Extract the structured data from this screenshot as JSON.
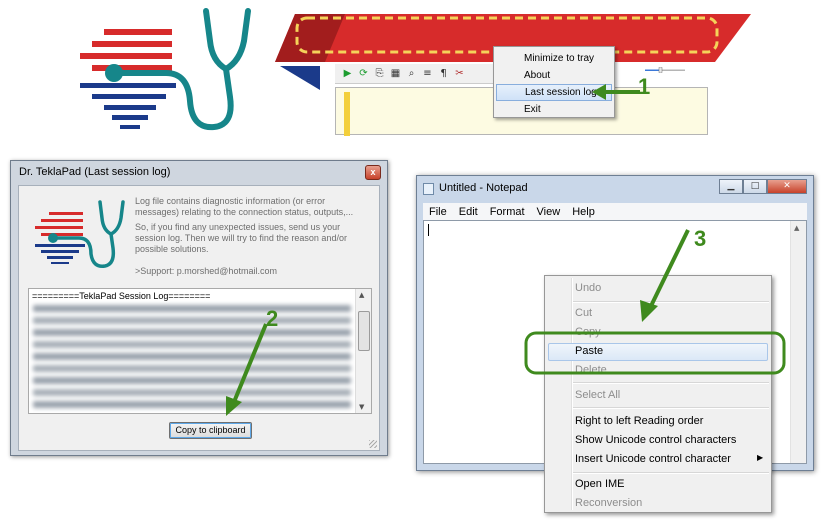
{
  "colors": {
    "brand_red": "#d72b2b",
    "brand_navy": "#1b3a8a",
    "stethoscope_teal": "#16868a",
    "annotation_green": "#3f8a1e",
    "highlight_yellow": "#f5d35a"
  },
  "top": {
    "tray_menu": {
      "items": [
        "Minimize to tray",
        "About",
        "Last session log",
        "Exit"
      ],
      "highlighted": "Last session log"
    },
    "toolbar_icons": [
      "play-icon",
      "refresh-icon",
      "bookmark-icon",
      "calculator-icon",
      "find-icon",
      "list-icon",
      "format-icon",
      "cut-icon"
    ],
    "step_number": "1"
  },
  "dialog": {
    "title": "Dr. TeklaPad (Last session log)",
    "close_glyph": "x",
    "info_lines": [
      "Log file contains diagnostic information (or error messages) relating to the connection status, outputs,...",
      "So, if you find any unexpected issues, send us your session log. Then we will try to find the reason and/or possible solutions."
    ],
    "support": ">Support: p.morshed@hotmail.com",
    "log_header": "=========TeklaPad Session Log========",
    "copy_button": "Copy to clipboard",
    "step_number": "2"
  },
  "notepad": {
    "title": "Untitled - Notepad",
    "menu": [
      "File",
      "Edit",
      "Format",
      "View",
      "Help"
    ],
    "context_menu": {
      "items": [
        {
          "label": "Undo",
          "disabled": true
        },
        {
          "label": "Cut",
          "disabled": true
        },
        {
          "label": "Copy",
          "disabled": true
        },
        {
          "label": "Paste",
          "disabled": false,
          "highlighted": true
        },
        {
          "label": "Delete",
          "disabled": true
        },
        {
          "label": "Select All",
          "disabled": true
        },
        {
          "label": "Right to left Reading order",
          "disabled": false
        },
        {
          "label": "Show Unicode control characters",
          "disabled": false
        },
        {
          "label": "Insert Unicode control character",
          "disabled": false,
          "submenu": true
        },
        {
          "label": "Open IME",
          "disabled": false
        },
        {
          "label": "Reconversion",
          "disabled": true
        }
      ]
    },
    "step_number": "3"
  }
}
